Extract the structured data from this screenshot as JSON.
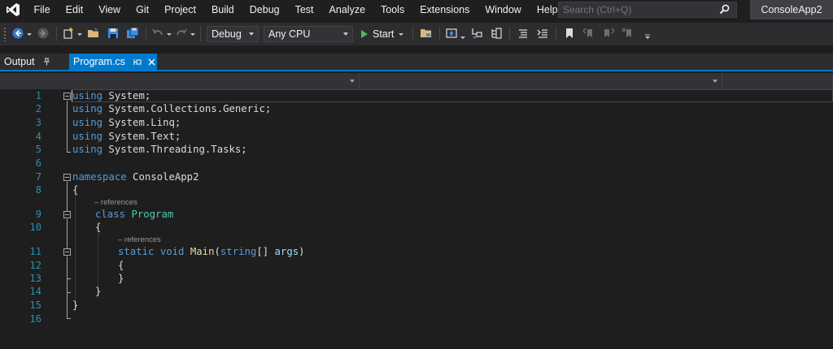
{
  "menubar": {
    "items": [
      "File",
      "Edit",
      "View",
      "Git",
      "Project",
      "Build",
      "Debug",
      "Test",
      "Analyze",
      "Tools",
      "Extensions",
      "Window",
      "Help"
    ],
    "search_placeholder": "Search (Ctrl+Q)",
    "solution_name": "ConsoleApp2"
  },
  "toolbar": {
    "configuration": "Debug",
    "platform": "Any CPU",
    "start_label": "Start"
  },
  "tabs": {
    "output_label": "Output",
    "active_label": "Program.cs"
  },
  "editor": {
    "line_numbers": [
      "1",
      "2",
      "3",
      "4",
      "5",
      "6",
      "7",
      "8",
      "9",
      "10",
      "11",
      "12",
      "13",
      "14",
      "15",
      "16"
    ],
    "lines": {
      "l1_kw": "using",
      "l1_rest": " System;",
      "l2_kw": "using",
      "l2_rest": " System.Collections.Generic;",
      "l3_kw": "using",
      "l3_rest": " System.Linq;",
      "l4_kw": "using",
      "l4_rest": " System.Text;",
      "l5_kw": "using",
      "l5_rest": " System.Threading.Tasks;",
      "l7_kw": "namespace",
      "l7_rest": " ConsoleApp2",
      "l8": "{",
      "l9_kw": "class",
      "l9_sp": " ",
      "l9_type": "Program",
      "l10": "{",
      "l11_kw1": "static",
      "l11_sp1": " ",
      "l11_kw2": "void",
      "l11_sp2": " ",
      "l11_method": "Main",
      "l11_p1": "(",
      "l11_kw3": "string",
      "l11_p2": "[] ",
      "l11_param": "args",
      "l11_p3": ")",
      "l12": "{",
      "l13": "}",
      "l14": "}",
      "l15": "}"
    },
    "codelens_class": "– references",
    "codelens_method": "– references"
  },
  "colors": {
    "accent": "#007acc",
    "keyword": "#569cd6",
    "type": "#4ec9b0",
    "method": "#dcdcaa",
    "parameter": "#9cdcfe",
    "line_number": "#2b91af",
    "start_icon": "#5bb35b"
  },
  "icons": [
    "visual-studio-logo",
    "search-icon",
    "back-icon",
    "forward-icon",
    "new-project-icon",
    "open-folder-icon",
    "save-icon",
    "save-all-icon",
    "undo-icon",
    "redo-icon",
    "start-icon",
    "pin-icon",
    "close-icon",
    "bookmark-icon"
  ]
}
